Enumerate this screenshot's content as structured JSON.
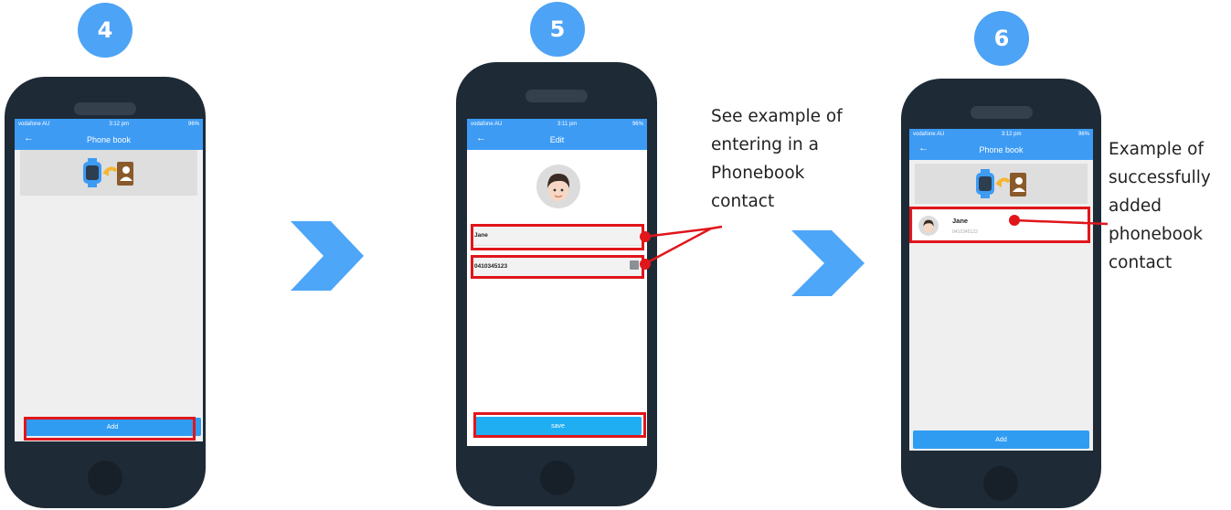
{
  "steps": [
    {
      "number": "4",
      "status": {
        "carrier": "vodafone AU",
        "time": "3:12 pm",
        "battery": "96%"
      },
      "title": "Phone book",
      "add_label": "Add"
    },
    {
      "number": "5",
      "status": {
        "carrier": "vodafone AU",
        "time": "3:11 pm",
        "battery": "96%"
      },
      "title": "Edit",
      "name_value": "Jane",
      "phone_value": "0410345123",
      "save_label": "save"
    },
    {
      "number": "6",
      "status": {
        "carrier": "vodafone AU",
        "time": "3:12 pm",
        "battery": "96%"
      },
      "title": "Phone book",
      "contact": {
        "name": "Jane",
        "number": "0410345123",
        "more": "···"
      },
      "add_label": "Add"
    }
  ],
  "captions": {
    "edit_note": [
      "See example of",
      "entering in a",
      "Phonebook",
      "contact"
    ],
    "added_note": [
      "Example of",
      "successfully",
      "added",
      "phonebook",
      "contact"
    ]
  },
  "colors": {
    "accent": "#3d9bf4",
    "highlight": "#e0161b",
    "badge": "#4da3f5",
    "chevron": "#4da6f7",
    "phone_body": "#1e2a36"
  },
  "icons": [
    "back-arrow-icon",
    "watch-icon",
    "contact-book-icon",
    "sync-arrow-icon",
    "avatar-icon",
    "contacts-picker-icon",
    "chevron-right-icon"
  ]
}
